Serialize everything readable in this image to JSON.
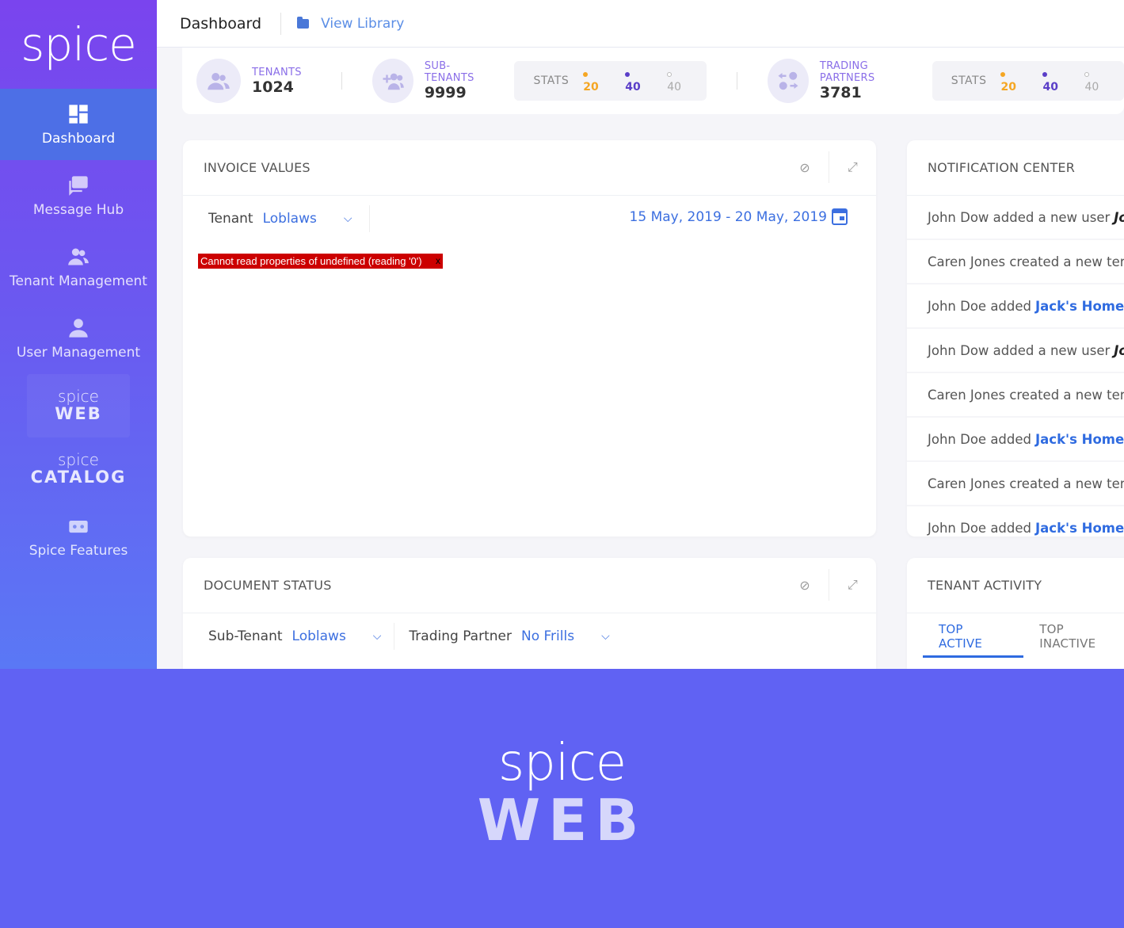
{
  "brand": {
    "name": "spice"
  },
  "sidebar": {
    "items": [
      {
        "label": "Dashboard",
        "icon": "dashboard-icon",
        "active": true
      },
      {
        "label": "Message Hub",
        "icon": "message-icon"
      },
      {
        "label": "Tenant Management",
        "icon": "users-icon"
      },
      {
        "label": "User Management",
        "icon": "user-icon"
      }
    ],
    "web_logo": {
      "top": "spice",
      "bottom": "WEB"
    },
    "catalog_logo": {
      "top": "spice",
      "bottom": "CATALOG"
    },
    "features": {
      "label": "Spice Features",
      "icon": "features-icon"
    }
  },
  "header": {
    "title": "Dashboard",
    "library_link": "View Library"
  },
  "stats": {
    "tenants": {
      "label": "TENANTS",
      "value": "1024"
    },
    "sub_tenants": {
      "label": "SUB-TENANTS",
      "value": "9999"
    },
    "trading_partners": {
      "label": "TRADING PARTNERS",
      "value": "3781"
    },
    "pill_label": "STATS",
    "pill_values": {
      "orange": "20",
      "purple": "40",
      "grey": "40"
    },
    "colors": {
      "orange": "#f5a623",
      "purple": "#5a3ec8",
      "grey": "#aaaaaa"
    }
  },
  "invoice_card": {
    "title": "INVOICE VALUES",
    "filter_label": "Tenant",
    "filter_value": "Loblaws",
    "date_range": "15 May, 2019 - 20 May, 2019",
    "error": "Cannot read properties of undefined (reading '0')",
    "error_close": "x"
  },
  "notification_card": {
    "title": "NOTIFICATION CENTER",
    "items": [
      {
        "text": "John Dow added a new user",
        "highlight": "John",
        "style": "italic"
      },
      {
        "text": "Caren Jones created a new tenant",
        "highlight": "",
        "style": ""
      },
      {
        "text": "John Doe added",
        "highlight": "Jack's Homemade",
        "style": "link"
      },
      {
        "text": "John Dow added a new user",
        "highlight": "John",
        "style": "italic"
      },
      {
        "text": "Caren Jones created a new tenant",
        "highlight": "",
        "style": ""
      },
      {
        "text": "John Doe added",
        "highlight": "Jack's Homemade",
        "style": "link"
      },
      {
        "text": "Caren Jones created a new tenant",
        "highlight": "",
        "style": ""
      },
      {
        "text": "John Doe added",
        "highlight": "Jack's Homemade",
        "style": "link"
      }
    ]
  },
  "document_card": {
    "title": "DOCUMENT STATUS",
    "filter1_label": "Sub-Tenant",
    "filter1_value": "Loblaws",
    "filter2_label": "Trading Partner",
    "filter2_value": "No Frills"
  },
  "activity_card": {
    "title": "TENANT ACTIVITY",
    "tabs": [
      {
        "label": "TOP ACTIVE",
        "active": true
      },
      {
        "label": "TOP INACTIVE"
      }
    ]
  },
  "banner": {
    "top": "spice",
    "bottom": "WEB"
  }
}
